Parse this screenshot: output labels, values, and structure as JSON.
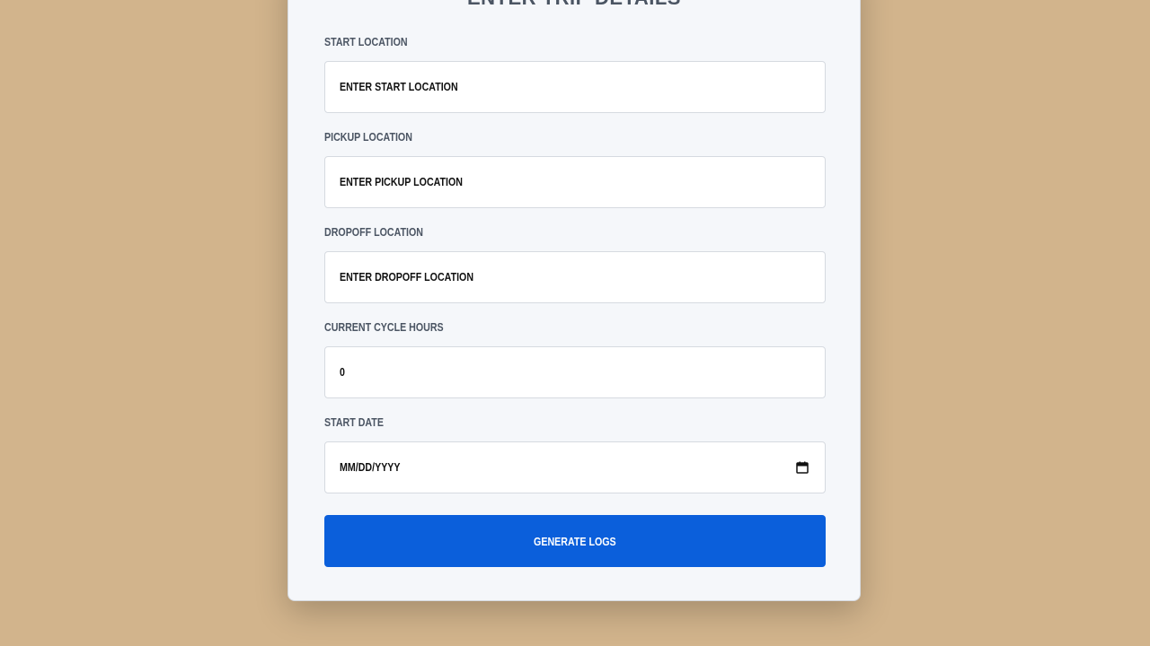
{
  "form": {
    "title": "Enter Trip Details",
    "fields": [
      {
        "label": "Start Location",
        "placeholder": "Enter start location"
      },
      {
        "label": "Pickup Location",
        "placeholder": "Enter pickup location"
      },
      {
        "label": "Dropoff Location",
        "placeholder": "Enter dropoff location"
      },
      {
        "label": "Current Cycle Hours",
        "value": "0"
      },
      {
        "label": "Start Date",
        "placeholder": "mm/dd/yyyy",
        "icon": "calendar-icon"
      }
    ],
    "submit_label": "Generate Logs"
  },
  "colors": {
    "background": "#D2B48C",
    "card": "#F5F7FA",
    "accent": "#0B5FDB"
  }
}
